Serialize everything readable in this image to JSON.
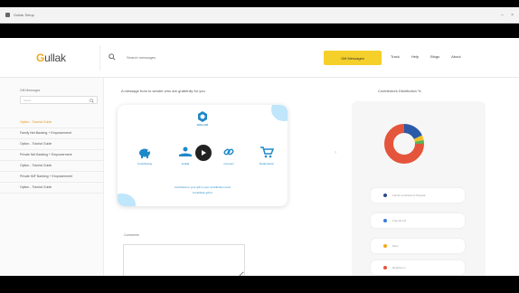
{
  "window": {
    "title": "Gullak Setup"
  },
  "header": {
    "logo_text": "Gullak",
    "search_placeholder": "Search messages",
    "cta_label": "Gift Messages",
    "nav": [
      "Track",
      "Help",
      "Blogs",
      "About"
    ]
  },
  "sidebar": {
    "label": "Gift Messages",
    "select_placeholder": "Select",
    "items": [
      {
        "label": "Option - Tutorial Guide",
        "active": true
      },
      {
        "label": "Family Net Banking + Empowerment"
      },
      {
        "label": "Option - Tutorial Guide"
      },
      {
        "label": "Private Net Banking + Empowerment"
      },
      {
        "label": "Option - Tutorial Guide"
      },
      {
        "label": "Private IMF Banking + Empowerment"
      },
      {
        "label": "Option - Tutorial Guide"
      }
    ]
  },
  "main": {
    "title": "A message from to sender who are gratefully for you",
    "card": {
      "brand": "GULLAK",
      "steps": [
        {
          "label": "Contributing",
          "icon": "piggy-bank-icon"
        },
        {
          "label": "Gullak",
          "icon": "hand-coin-icon"
        },
        {
          "label": "Connect",
          "icon": "link-icon"
        },
        {
          "label": "Redemption",
          "icon": "cart-icon"
        }
      ],
      "link_text": "Contribute to your gift in your contribution room",
      "link_text_2": "Contribute gift to"
    },
    "comments_label": "Comments"
  },
  "right_panel": {
    "title": "Contributors Distribution %",
    "legend": [
      {
        "label": "Family contributors Sheetal",
        "color": "#2c4a86"
      },
      {
        "label": "Friends 1%",
        "color": "#3b7dd8"
      },
      {
        "label": "Mom",
        "color": "#f2a81d"
      },
      {
        "label": "Relatives 1",
        "color": "#e4553b"
      }
    ]
  },
  "chart_data": {
    "type": "pie",
    "categories": [
      "Blue",
      "Yellow",
      "Green",
      "Red"
    ],
    "values": [
      18,
      4,
      3,
      75
    ],
    "colors": [
      "#2b5aa8",
      "#f2c026",
      "#5bb15a",
      "#e4553b"
    ]
  }
}
